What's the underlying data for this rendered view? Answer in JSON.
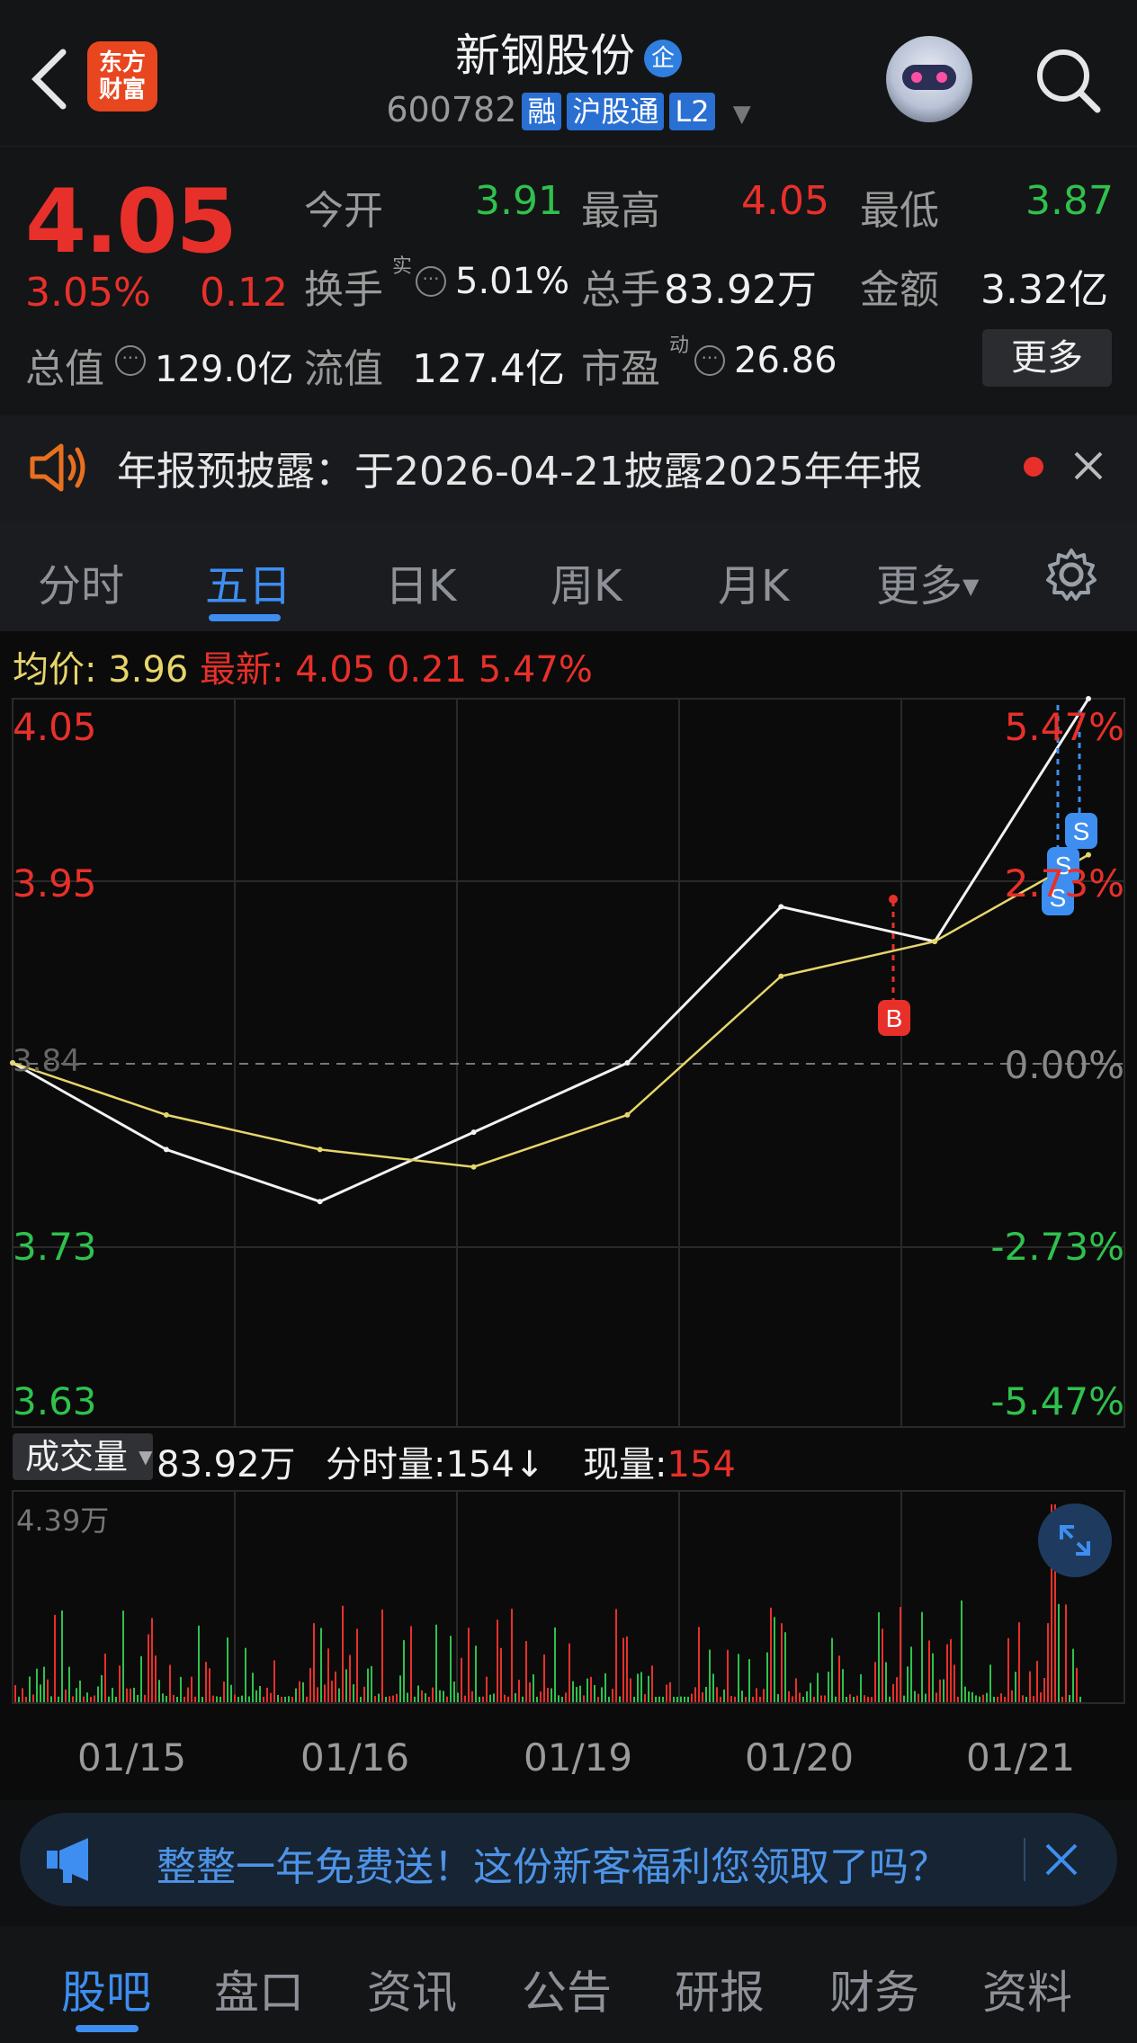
{
  "header": {
    "logo_line1": "东方",
    "logo_line2": "财富",
    "stock_name": "新钢股份",
    "enterprise_badge": "企",
    "stock_code": "600782",
    "tags": [
      "融",
      "沪股通",
      "L2"
    ]
  },
  "quote": {
    "price": "4.05",
    "change_pct": "3.05%",
    "change_amt": "0.12",
    "fields": {
      "open_label": "今开",
      "open_value": "3.91",
      "high_label": "最高",
      "high_value": "4.05",
      "low_label": "最低",
      "low_value": "3.87",
      "turnover_label": "换手",
      "turnover_sup": "实",
      "turnover_value": "5.01%",
      "volume_label": "总手",
      "volume_value": "83.92万",
      "amount_label": "金额",
      "amount_value": "3.32亿",
      "mktcap_label": "总值",
      "mktcap_value": "129.0亿",
      "float_label": "流值",
      "float_value": "127.4亿",
      "pe_label": "市盈",
      "pe_sup": "动",
      "pe_value": "26.86"
    },
    "more_label": "更多"
  },
  "notice": {
    "text": "年报预披露：于2026-04-21披露2025年年报"
  },
  "tabs": [
    "分时",
    "五日",
    "日K",
    "周K",
    "月K",
    "更多"
  ],
  "active_tab": 1,
  "chart": {
    "avg_label": "均价:",
    "avg_value": "3.96",
    "latest_label": "最新:",
    "latest_value": "4.05",
    "latest_change": "0.21",
    "latest_pct": "5.47%",
    "price_axis": [
      "4.05",
      "3.95",
      "3.73",
      "3.63"
    ],
    "pct_axis": [
      "5.47%",
      "2.73%",
      "0.00%",
      "-2.73%",
      "-5.47%"
    ],
    "ref_label": "3.84",
    "markers": [
      "B",
      "S",
      "S",
      "S"
    ],
    "volume_selector": "成交量",
    "volume_total": "83.92万",
    "tick_volume_label": "分时量:154↓",
    "current_volume_label": "现量:",
    "current_volume_value": "154",
    "volume_max_label": "4.39万",
    "dates": [
      "01/15",
      "01/16",
      "01/19",
      "01/20",
      "01/21"
    ]
  },
  "chart_data": {
    "type": "line",
    "x": [
      "01/15",
      "01/16",
      "01/19",
      "01/20",
      "01/21"
    ],
    "series": [
      {
        "name": "最新",
        "values": [
          3.84,
          3.79,
          3.76,
          3.8,
          3.84,
          3.93,
          3.91,
          4.05
        ]
      },
      {
        "name": "均价",
        "values": [
          3.84,
          3.81,
          3.79,
          3.78,
          3.81,
          3.89,
          3.91,
          3.96
        ]
      }
    ],
    "ylim": [
      3.63,
      4.05
    ],
    "reference": 3.84
  },
  "promo": {
    "text": "整整一年免费送！这份新客福利您领取了吗？"
  },
  "bottom_nav": [
    "股吧",
    "盘口",
    "资讯",
    "公告",
    "研报",
    "财务",
    "资料"
  ],
  "colors": {
    "up": "#e8302a",
    "down": "#2fc14d",
    "accent": "#3d8ef0",
    "avg_line": "#e6d56a"
  }
}
